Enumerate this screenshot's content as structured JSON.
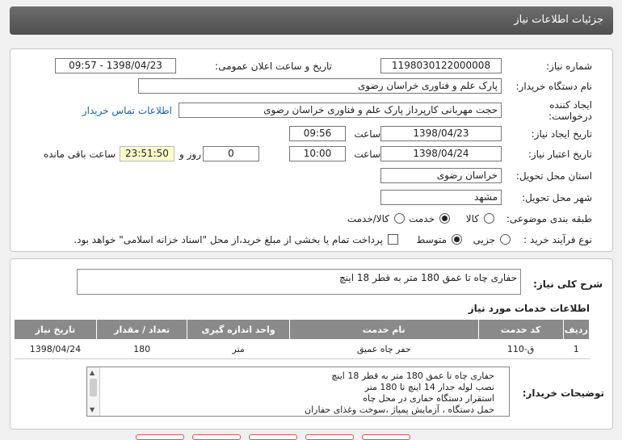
{
  "header": {
    "title": "جزئیات اطلاعات نیاز"
  },
  "info": {
    "need_number_label": "شماره نیاز:",
    "need_number": "1198030122000008",
    "announce_label": "تاریخ و ساعت اعلان عمومی:",
    "announce_value": "1398/04/23 - 09:57",
    "buyer_label": "نام دستگاه خریدار:",
    "buyer": "پارک علم و فناوری خراسان رضوی",
    "creator_label_1": "ایجاد کننده",
    "creator_label_2": "درخواست:",
    "creator": "حجت مهربانی کارپرداز پارک علم و فناوری خراسان رضوی",
    "contact_link": "اطلاعات تماس خریدار",
    "created_date_label": "تاریخ ایجاد نیاز:",
    "created_date": "1398/04/23",
    "time_label": "ساعت",
    "created_time": "09:56",
    "validity_label": "تاریخ اعتبار نیاز:",
    "validity_date": "1398/04/24",
    "validity_time": "10:00",
    "days_remaining": "0",
    "days_label": "روز و",
    "time_remaining": "23:51:50",
    "remaining_label": "ساعت باقی مانده",
    "province_label": "استان محل تحویل:",
    "province": "خراسان رضوی",
    "city_label": "شهر محل تحویل:",
    "city": "مشهد",
    "category_label": "طبقه بندی موضوعی:",
    "category_options": [
      "کالا",
      "خدمت",
      "کالا/خدمت"
    ],
    "category_selected": "خدمت",
    "process_label": "نوع فرآیند خرید :",
    "process_options": [
      "جزیی",
      "متوسط"
    ],
    "process_selected": "متوسط",
    "payment_note": "پرداخت تمام یا بخشی از مبلغ خرید،از محل \"اسناد خزانه اسلامی\" خواهد بود."
  },
  "summary": {
    "label": "شرح کلی نیاز:",
    "text": "حفاری چاه تا عمق 180 متر به قطر 18 اینچ"
  },
  "services": {
    "title": "اطلاعات خدمات مورد نیاز",
    "columns": [
      "ردیف",
      "کد خدمت",
      "نام خدمت",
      "واحد اندازه گیری",
      "تعداد / مقدار",
      "تاریخ نیاز"
    ],
    "rows": [
      [
        "1",
        "ق-110",
        "حفر چاه عمیق",
        "متر",
        "180",
        "1398/04/24"
      ]
    ]
  },
  "buyer_notes": {
    "label": "توضیحات خریدار:",
    "lines": [
      "حفاری چاه تا عمق 180 متر به قطر 18 اینچ",
      "نصب لوله جدار 14 اینچ تا 180 متر",
      "استقرار دستگاه حفاری در محل چاه",
      "حمل دستگاه ، آزمایش پمپاژ ،سوخت وغذای حفاران"
    ]
  },
  "colors": {
    "titlebar": "#5a5a5a",
    "table_header": "#8a8a8a",
    "link": "#1a5fb4",
    "remaining_bg": "#ffffcc"
  }
}
